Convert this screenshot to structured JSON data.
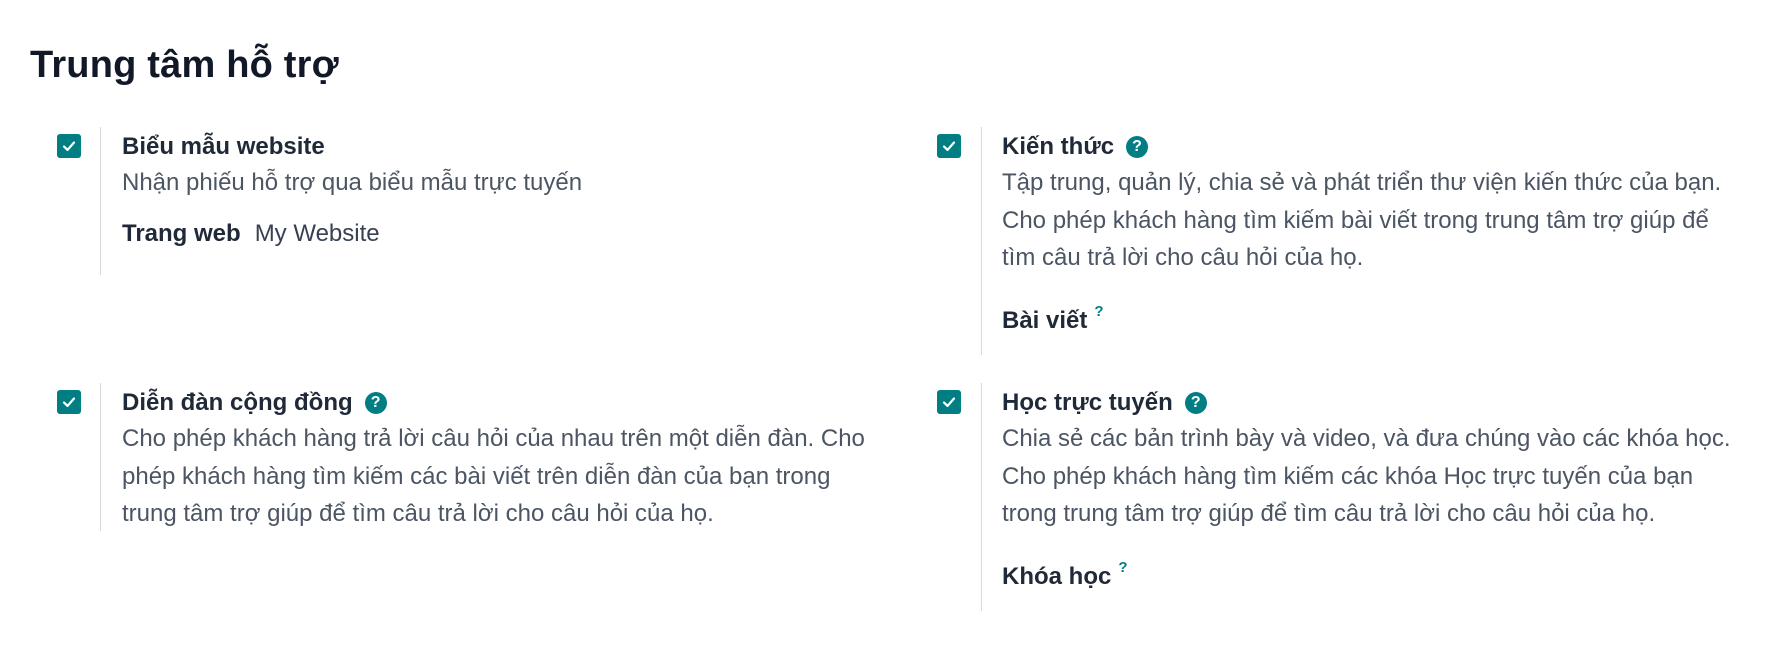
{
  "section": {
    "title": "Trung tâm hỗ trợ"
  },
  "settings": [
    {
      "title": "Biểu mẫu website",
      "checked": true,
      "description_lines": [
        "Nhận phiếu hỗ trợ qua biểu mẫu trực tuyến"
      ],
      "field_label": "Trang web",
      "field_value": "My Website"
    },
    {
      "title": "Kiến thức",
      "checked": true,
      "description_lines": [
        "Tập trung, quản lý, chia sẻ và phát triển thư viện kiến thức của bạn.",
        "Cho phép khách hàng tìm kiếm bài viết trong trung tâm trợ giúp để",
        "tìm câu trả lời cho câu hỏi của họ."
      ],
      "field_label": "Bài viết",
      "field_help": "?"
    },
    {
      "title": "Diễn đàn cộng đồng",
      "checked": true,
      "description_lines": [
        "Cho phép khách hàng trả lời câu hỏi của nhau trên một diễn đàn. Cho",
        "phép khách hàng tìm kiếm các bài viết trên diễn đàn của bạn trong",
        "trung tâm trợ giúp để tìm câu trả lời cho câu hỏi của họ."
      ]
    },
    {
      "title": "Học trực tuyến",
      "checked": true,
      "description_lines": [
        "Chia sẻ các bản trình bày và video, và đưa chúng vào các khóa học.",
        "Cho phép khách hàng tìm kiếm các khóa Học trực tuyến của bạn",
        "trong trung tâm trợ giúp để tìm câu trả lời cho câu hỏi của họ."
      ],
      "field_label": "Khóa học",
      "field_help": "?"
    }
  ],
  "help_icon_glyph": "?",
  "colors": {
    "accent": "#017e84",
    "title": "#111827",
    "text": "#4b5563",
    "divider": "#d8dadd"
  }
}
